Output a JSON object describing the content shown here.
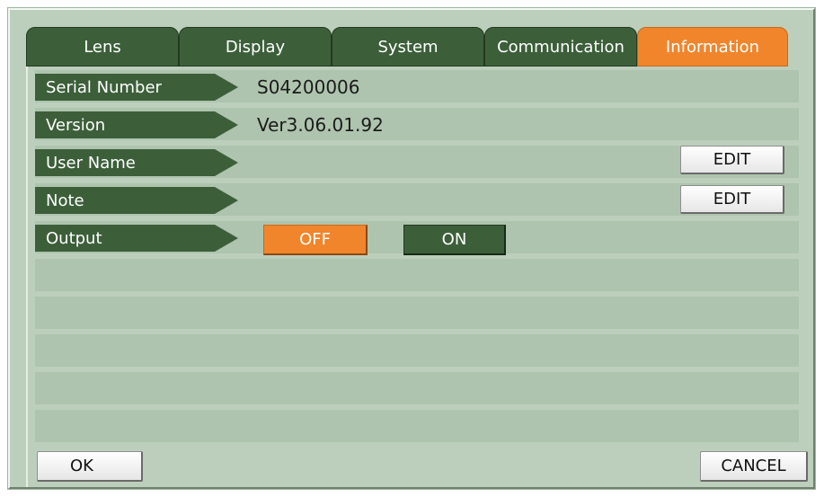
{
  "tabs": [
    {
      "label": "Lens"
    },
    {
      "label": "Display"
    },
    {
      "label": "System"
    },
    {
      "label": "Communication"
    },
    {
      "label": "Information",
      "active": true
    }
  ],
  "rows": [
    {
      "label": "Serial Number",
      "value": "S04200006"
    },
    {
      "label": "Version",
      "value": "Ver3.06.01.92"
    },
    {
      "label": "User Name",
      "edit_label": "EDIT"
    },
    {
      "label": "Note",
      "edit_label": "EDIT"
    },
    {
      "label": "Output",
      "off_label": "OFF",
      "on_label": "ON",
      "selected": "OFF"
    }
  ],
  "footer": {
    "ok_label": "OK",
    "cancel_label": "CANCEL"
  },
  "colors": {
    "background": "#bccfbc",
    "stripe": "#aec4ae",
    "tab": "#3c5f3a",
    "active_tab": "#f0852c"
  }
}
